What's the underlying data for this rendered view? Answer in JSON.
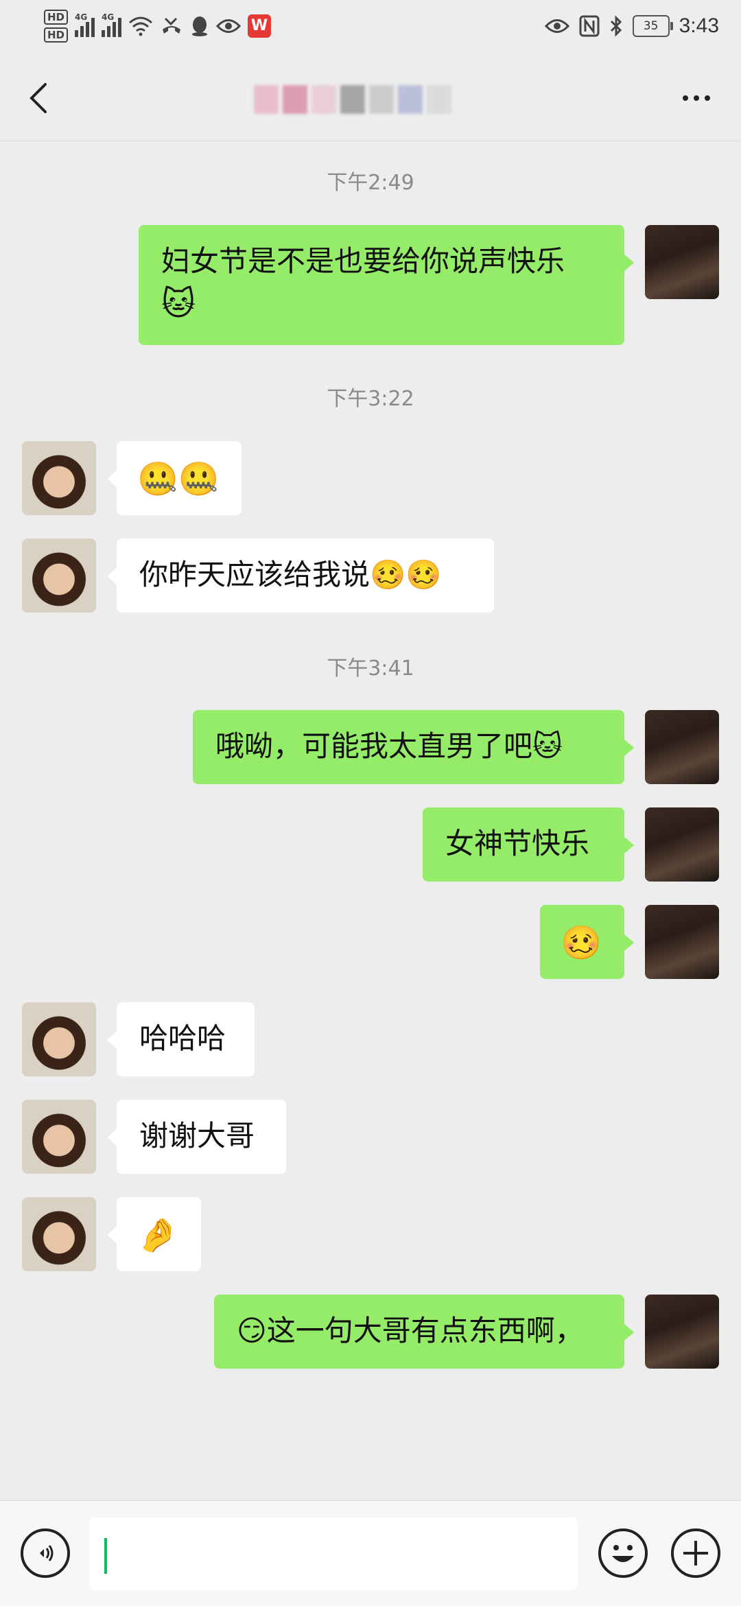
{
  "status_bar": {
    "hd1": "HD",
    "hd2": "HD",
    "net1": "4G",
    "net2": "4G",
    "battery": "35",
    "time": "3:43",
    "wps_label": "W",
    "icons": [
      "hd-icon",
      "signal-icon",
      "wifi-icon",
      "missed-call-icon",
      "qq-icon",
      "eye-icon",
      "wps-icon",
      "nfc-icon",
      "bluetooth-icon",
      "battery-icon"
    ]
  },
  "header": {
    "contact_name_blurred": true,
    "back_icon": "chevron-left-icon",
    "more_icon": "more-dots-icon"
  },
  "messages": [
    {
      "type": "time",
      "text": "下午2:49"
    },
    {
      "type": "msg",
      "side": "mine",
      "lines": [
        "妇女节是不是也要给你说声快乐",
        "🐱"
      ]
    },
    {
      "type": "time",
      "text": "下午3:22"
    },
    {
      "type": "msg",
      "side": "theirs",
      "text": "🤐🤐"
    },
    {
      "type": "msg",
      "side": "theirs",
      "text": "你昨天应该给我说🥴🥴"
    },
    {
      "type": "time",
      "text": "下午3:41"
    },
    {
      "type": "msg",
      "side": "mine",
      "text": "哦呦，可能我太直男了吧🐱"
    },
    {
      "type": "msg",
      "side": "mine",
      "text": "女神节快乐"
    },
    {
      "type": "msg",
      "side": "mine",
      "text": "🥴"
    },
    {
      "type": "msg",
      "side": "theirs",
      "text": "哈哈哈"
    },
    {
      "type": "msg",
      "side": "theirs",
      "text": "谢谢大哥"
    },
    {
      "type": "msg",
      "side": "theirs",
      "text": "🤌"
    },
    {
      "type": "msg",
      "side": "mine",
      "text": "😏这一句大哥有点东西啊，"
    }
  ],
  "input_bar": {
    "value": "",
    "voice_icon": "voice-icon",
    "emoji_icon": "emoji-icon",
    "plus_icon": "plus-icon"
  },
  "colors": {
    "background": "#ededed",
    "mine_bubble": "#95ec69",
    "theirs_bubble": "#ffffff",
    "caret": "#07c160",
    "time_text": "#8a8a8a"
  }
}
